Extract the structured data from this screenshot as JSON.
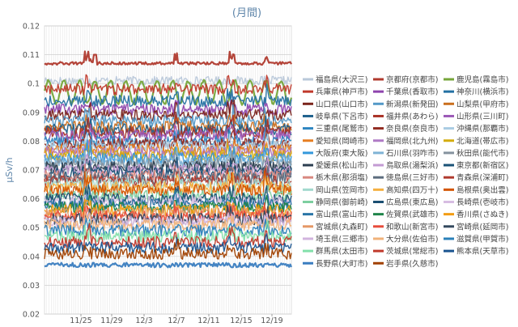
{
  "chart_data": {
    "type": "line",
    "title": "(月間)",
    "ylabel": "μSv/h",
    "ylim": [
      0.02,
      0.12
    ],
    "y_ticks": [
      "0.02",
      "0.03",
      "0.04",
      "0.05",
      "0.06",
      "0.07",
      "0.08",
      "0.09",
      "0.1",
      "0.11",
      "0.12"
    ],
    "x_ticks": [
      "11/25",
      "11/29",
      "12/3",
      "12/7",
      "12/11",
      "12/15",
      "12/19"
    ],
    "grid": true,
    "legend_position": "right",
    "series": [
      {
        "name": "福島県(大沢三)",
        "color": "#b9c8da",
        "base": 0.101,
        "amp": 0.0015,
        "spike": 0.0
      },
      {
        "name": "京都府(京都市)",
        "color": "#b03a2e",
        "base": 0.107,
        "amp": 0.0005,
        "spike": 0.004
      },
      {
        "name": "鹿児島(霧島市)",
        "color": "#76a63a",
        "base": 0.097,
        "amp": 0.004,
        "spike": 0.0
      },
      {
        "name": "兵庫県(神戸市)",
        "color": "#c0392b",
        "base": 0.098,
        "amp": 0.002,
        "spike": 0.005
      },
      {
        "name": "千葉県(香取市)",
        "color": "#8e44ad",
        "base": 0.091,
        "amp": 0.002,
        "spike": 0.003
      },
      {
        "name": "神奈川(横浜市)",
        "color": "#2471a3",
        "base": 0.094,
        "amp": 0.002,
        "spike": 0.004
      },
      {
        "name": "山口県(山口市)",
        "color": "#7b241c",
        "base": 0.089,
        "amp": 0.002,
        "spike": 0.004
      },
      {
        "name": "新潟県(新発田)",
        "color": "#5499c7",
        "base": 0.087,
        "amp": 0.002,
        "spike": 0.005
      },
      {
        "name": "山梨県(甲府市)",
        "color": "#ca6f1e",
        "base": 0.085,
        "amp": 0.002,
        "spike": 0.003
      },
      {
        "name": "岐阜県(下呂市)",
        "color": "#1f618d",
        "base": 0.084,
        "amp": 0.002,
        "spike": 0.004
      },
      {
        "name": "福井県(あわら)",
        "color": "#a93226",
        "base": 0.083,
        "amp": 0.002,
        "spike": 0.006
      },
      {
        "name": "山形県(三川町)",
        "color": "#9b59b6",
        "base": 0.082,
        "amp": 0.002,
        "spike": 0.003
      },
      {
        "name": "三重県(尾鷲市)",
        "color": "#2e86c1",
        "base": 0.08,
        "amp": 0.002,
        "spike": 0.004
      },
      {
        "name": "奈良県(奈良市)",
        "color": "#922b21",
        "base": 0.079,
        "amp": 0.002,
        "spike": 0.005
      },
      {
        "name": "沖縄県(那覇市)",
        "color": "#a9cce3",
        "base": 0.078,
        "amp": 0.002,
        "spike": 0.003
      },
      {
        "name": "愛知県(岡崎市)",
        "color": "#e67e22",
        "base": 0.077,
        "amp": 0.002,
        "spike": 0.004
      },
      {
        "name": "福岡県(北九州)",
        "color": "#af7ac5",
        "base": 0.076,
        "amp": 0.002,
        "spike": 0.003
      },
      {
        "name": "北海道(帯広市)",
        "color": "#d4ac0d",
        "base": 0.075,
        "amp": 0.002,
        "spike": 0.004
      },
      {
        "name": "大阪府(東大阪)",
        "color": "#3498db",
        "base": 0.074,
        "amp": 0.002,
        "spike": 0.005
      },
      {
        "name": "石川県(羽咋市)",
        "color": "#7fb3d5",
        "base": 0.073,
        "amp": 0.002,
        "spike": 0.003
      },
      {
        "name": "秋田県(能代市)",
        "color": "#85929e",
        "base": 0.072,
        "amp": 0.002,
        "spike": 0.004
      },
      {
        "name": "愛媛県(松山市)",
        "color": "#2c3e50",
        "base": 0.071,
        "amp": 0.002,
        "spike": 0.003
      },
      {
        "name": "鳥取県(湯梨浜)",
        "color": "#c39bd3",
        "base": 0.07,
        "amp": 0.002,
        "spike": 0.004
      },
      {
        "name": "東京都(新宿区)",
        "color": "#1a5276",
        "base": 0.069,
        "amp": 0.002,
        "spike": 0.005
      },
      {
        "name": "栃木県(那須塩)",
        "color": "#d98880",
        "base": 0.068,
        "amp": 0.002,
        "spike": 0.003
      },
      {
        "name": "徳島県(三好市)",
        "color": "#5d6d7e",
        "base": 0.067,
        "amp": 0.002,
        "spike": 0.004
      },
      {
        "name": "青森県(深浦町)",
        "color": "#b03a2e",
        "base": 0.066,
        "amp": 0.002,
        "spike": 0.005
      },
      {
        "name": "岡山県(笠岡市)",
        "color": "#a2d9ce",
        "base": 0.065,
        "amp": 0.002,
        "spike": 0.003
      },
      {
        "name": "高知県(四万十)",
        "color": "#f5b041",
        "base": 0.064,
        "amp": 0.002,
        "spike": 0.004
      },
      {
        "name": "島根県(奥出雲)",
        "color": "#d35400",
        "base": 0.063,
        "amp": 0.002,
        "spike": 0.005
      },
      {
        "name": "静岡県(御前崎)",
        "color": "#7dcea0",
        "base": 0.061,
        "amp": 0.002,
        "spike": 0.003
      },
      {
        "name": "広島県(東広島)",
        "color": "#1b4f72",
        "base": 0.06,
        "amp": 0.002,
        "spike": 0.004
      },
      {
        "name": "長崎県(壱岐市)",
        "color": "#d7bde2",
        "base": 0.059,
        "amp": 0.002,
        "spike": 0.003
      },
      {
        "name": "富山県(富山市)",
        "color": "#2874a6",
        "base": 0.058,
        "amp": 0.002,
        "spike": 0.004
      },
      {
        "name": "佐賀県(武雄市)",
        "color": "#1e8449",
        "base": 0.057,
        "amp": 0.002,
        "spike": 0.003
      },
      {
        "name": "香川県(さぬき)",
        "color": "#f39c12",
        "base": 0.056,
        "amp": 0.002,
        "spike": 0.004
      },
      {
        "name": "宮城県(丸森町)",
        "color": "#e59866",
        "base": 0.055,
        "amp": 0.002,
        "spike": 0.003
      },
      {
        "name": "和歌山(新宮市)",
        "color": "#e74c3c",
        "base": 0.054,
        "amp": 0.002,
        "spike": 0.004
      },
      {
        "name": "宮崎県(延岡市)",
        "color": "#34495e",
        "base": 0.053,
        "amp": 0.002,
        "spike": 0.005
      },
      {
        "name": "埼玉県(三郷市)",
        "color": "#d2b4de",
        "base": 0.052,
        "amp": 0.002,
        "spike": 0.003
      },
      {
        "name": "大分県(佐伯市)",
        "color": "#f0b27a",
        "base": 0.051,
        "amp": 0.002,
        "spike": 0.004
      },
      {
        "name": "滋賀県(甲賀市)",
        "color": "#2980b9",
        "base": 0.049,
        "amp": 0.002,
        "spike": 0.003
      },
      {
        "name": "群馬県(太田市)",
        "color": "#82e0aa",
        "base": 0.047,
        "amp": 0.002,
        "spike": 0.004
      },
      {
        "name": "茨城県(常総市)",
        "color": "#c0392b",
        "base": 0.045,
        "amp": 0.002,
        "spike": 0.005
      },
      {
        "name": "熊本県(天草市)",
        "color": "#1a5490",
        "base": 0.043,
        "amp": 0.002,
        "spike": 0.003
      },
      {
        "name": "長野県(大町市)",
        "color": "#3a7dc0",
        "base": 0.037,
        "amp": 0.0008,
        "spike": 0.0
      },
      {
        "name": "岩手県(久慈市)",
        "color": "#a04000",
        "base": 0.041,
        "amp": 0.002,
        "spike": 0.004
      }
    ]
  }
}
